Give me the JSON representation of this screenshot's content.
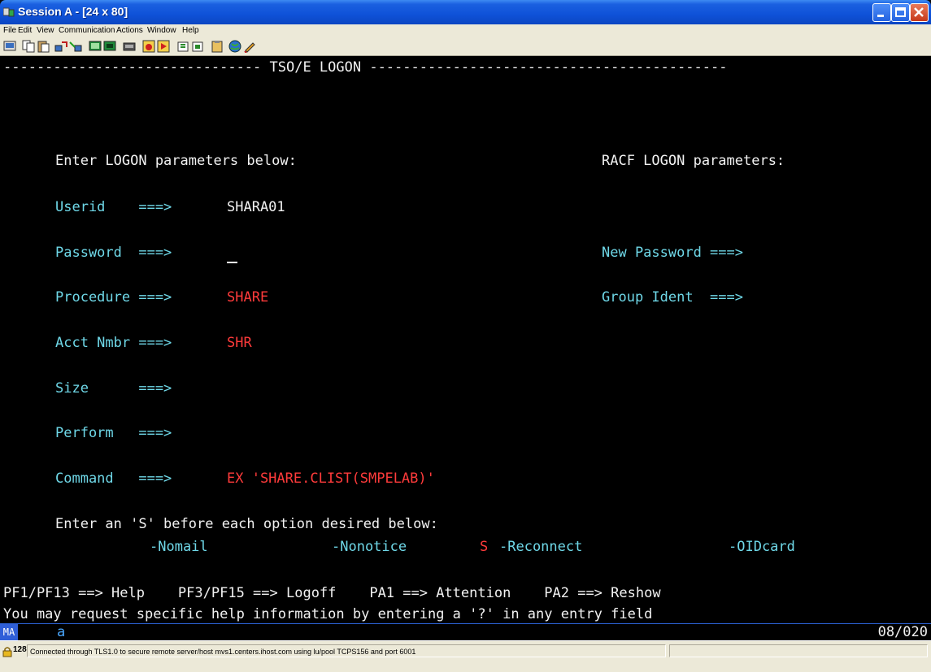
{
  "window": {
    "title": "Session A - [24 x 80]"
  },
  "menu": [
    "File",
    "Edit",
    "View",
    "Communication",
    "Actions",
    "Window",
    "Help"
  ],
  "toolbar_icons": [
    "print-screen-icon",
    "copy-icon",
    "paste-icon",
    "send-file-icon",
    "receive-file-icon",
    "display-icon",
    "keyboard-icon",
    "macro-icon",
    "record-macro-icon",
    "play-macro-icon",
    "start-icon",
    "stop-icon",
    "clipboard-icon",
    "globe-icon",
    "edit-icon"
  ],
  "screen": {
    "header_line": "------------------------------- TSO/E LOGON -------------------------------------------",
    "left_heading": "Enter LOGON parameters below:",
    "right_heading": "RACF LOGON parameters:",
    "fields": {
      "userid": {
        "label": "Userid    ===>",
        "value": "SHARA01"
      },
      "password": {
        "label": "Password  ===>",
        "value": ""
      },
      "procedure": {
        "label": "Procedure ===>",
        "value": "SHARE"
      },
      "acct": {
        "label": "Acct Nmbr ===>",
        "value": "SHR"
      },
      "size": {
        "label": "Size      ===>",
        "value": ""
      },
      "perform": {
        "label": "Perform   ===>",
        "value": ""
      },
      "command": {
        "label": "Command   ===>",
        "value": "EX 'SHARE.CLIST(SMPELAB)'"
      }
    },
    "right_fields": {
      "new_password": {
        "label": "New Password ===>"
      },
      "group_ident": {
        "label": "Group Ident  ===>"
      }
    },
    "option_prompt": "Enter an 'S' before each option desired below:",
    "options": {
      "nomail": {
        "selection": "",
        "label": "-Nomail"
      },
      "nonotice": {
        "selection": "",
        "label": "-Nonotice"
      },
      "reconnect": {
        "selection": "S",
        "label": "-Reconnect"
      },
      "oidcard": {
        "selection": "",
        "label": "-OIDcard"
      }
    },
    "pf_line": "PF1/PF13 ==> Help    PF3/PF15 ==> Logoff    PA1 ==> Attention    PA2 ==> Reshow",
    "help_line": "You may request specific help information by entering a '?' in any entry field"
  },
  "oia": {
    "mode": "MA",
    "indicator": "a",
    "cursor_position": "08/020"
  },
  "statusbar": {
    "bits": "128",
    "message": "Connected through TLS1.0 to secure remote server/host mvs1.centers.ihost.com using lu/pool TCPS156 and port 6001"
  },
  "colors": {
    "field_label": "#6fd8e8",
    "protected_text": "#f2f2f2",
    "input_value": "#ff3b3b",
    "title_bar": "#0f52d8",
    "chrome": "#ece9d8"
  }
}
